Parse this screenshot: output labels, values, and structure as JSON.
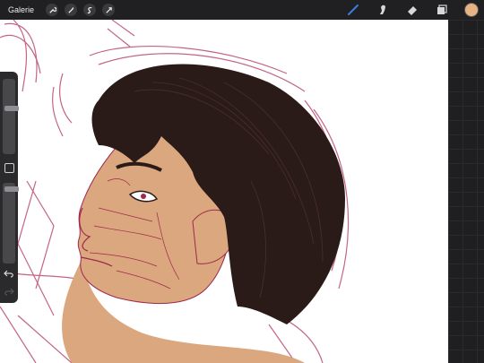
{
  "topbar": {
    "gallery_label": "Galerie",
    "left_tools": [
      "wrench-icon",
      "magic-wand-icon",
      "selection-icon",
      "transform-icon"
    ],
    "right_tools": [
      "brush-icon",
      "smudge-icon",
      "eraser-icon",
      "layers-icon"
    ],
    "active_tool": "brush-icon",
    "accent_color": "#3b7ddd",
    "current_color": "#e8b384"
  },
  "sidebar": {
    "brush_size": 0.14,
    "brush_opacity": 0.0
  },
  "artwork": {
    "description_colors": {
      "skin": "#dba77e",
      "hair": "#2b1b18",
      "line": "#a0274e"
    }
  }
}
